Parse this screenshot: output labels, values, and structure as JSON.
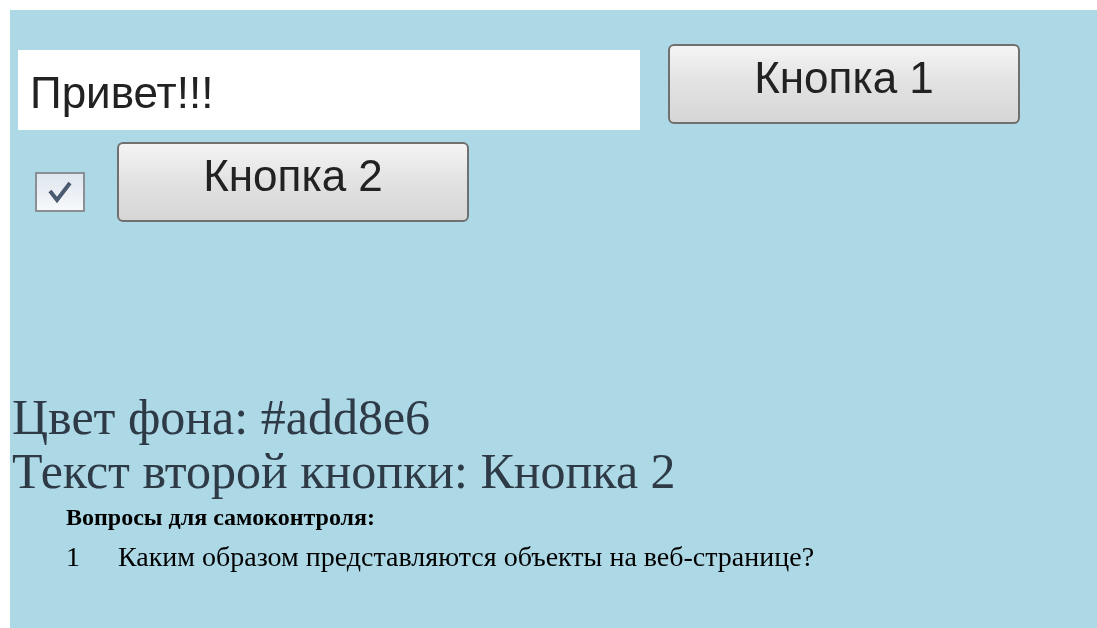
{
  "form": {
    "text_field": {
      "value": "Привет!!!"
    },
    "button_1": {
      "label": "Кнопка 1"
    },
    "checkbox": {
      "checked": true
    },
    "button_2": {
      "label": "Кнопка 2"
    }
  },
  "output_lines": [
    "Цвет фона: #add8e6",
    "Текст второй кнопки: Кнопка 2"
  ],
  "document_overlay": {
    "heading": "Вопросы для самоконтроля:",
    "questions": [
      {
        "number": "1",
        "text": "Каким образом представляются объекты на веб-странице?"
      }
    ]
  }
}
